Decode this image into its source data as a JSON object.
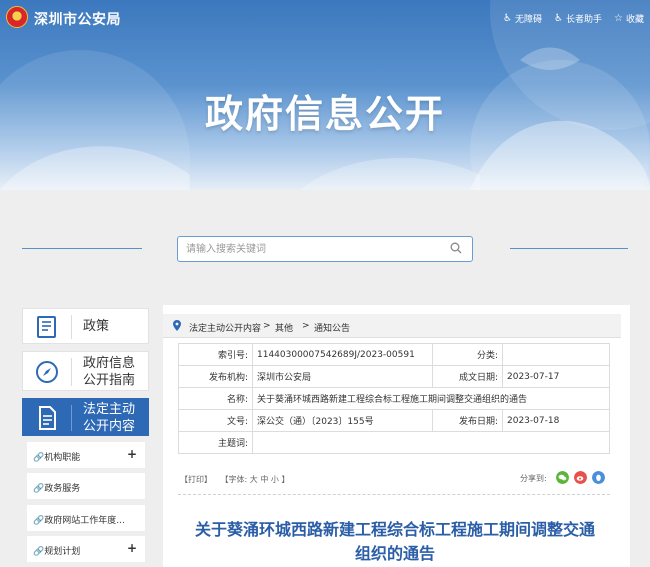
{
  "header": {
    "site_name": "深圳市公安局",
    "tools": [
      {
        "icon": "accessibility-icon",
        "label": "无障碍"
      },
      {
        "icon": "elder-assistant-icon",
        "label": "长者助手"
      },
      {
        "icon": "star-icon",
        "label": "收藏"
      }
    ],
    "banner_title": "政府信息公开"
  },
  "search": {
    "placeholder": "请输入搜索关键词"
  },
  "sidebar": {
    "cards": [
      {
        "icon": "book-icon",
        "label": "政策"
      },
      {
        "icon": "compass-icon",
        "label_line1": "政府信息",
        "label_line2": "公开指南"
      },
      {
        "icon": "document-icon",
        "label_line1": "法定主动",
        "label_line2": "公开内容",
        "active": true
      }
    ],
    "sub_items": [
      {
        "label": "机构职能",
        "expandable": true
      },
      {
        "label": "政务服务",
        "expandable": false
      },
      {
        "label": "政府网站工作年度...",
        "expandable": false
      },
      {
        "label": "规划计划",
        "expandable": true
      }
    ],
    "sub_prefix": "🔗"
  },
  "breadcrumb": {
    "items": [
      "法定主动公开内容",
      "其他",
      "通知公告"
    ],
    "separator": ">"
  },
  "meta": {
    "index_label": "索引号:",
    "index_value": "11440300007542689J/2023-00591",
    "category_label": "分类:",
    "category_value": "",
    "publisher_label": "发布机构:",
    "publisher_value": "深圳市公安局",
    "created_label": "成文日期:",
    "created_value": "2023-07-17",
    "name_label": "名称:",
    "name_value": "关于葵涌环城西路新建工程综合标工程施工期间调整交通组织的通告",
    "doc_no_label": "文号:",
    "doc_no_value": "深公交（通）〔2023〕155号",
    "published_label": "发布日期:",
    "published_value": "2023-07-18",
    "subject_label": "主题词:",
    "subject_value": ""
  },
  "article_tools": {
    "print": "【打印】",
    "font_prefix": "【字体:",
    "font_large": "大",
    "font_medium": "中",
    "font_small": "小",
    "font_suffix": "】",
    "share_label": "分享到:",
    "share_targets": [
      {
        "icon": "wechat-icon",
        "color": "#5bb53b"
      },
      {
        "icon": "weibo-icon",
        "color": "#e6514a"
      },
      {
        "icon": "qq-icon",
        "color": "#4a90d9"
      }
    ]
  },
  "article": {
    "title_line1": "关于葵涌环城西路新建工程综合标工程施工期间调整交通",
    "title_line2": "组织的通告"
  },
  "colors": {
    "primary": "#2e69b5",
    "title_blue": "#2b5ea7",
    "banner_top": "#3c78be"
  }
}
